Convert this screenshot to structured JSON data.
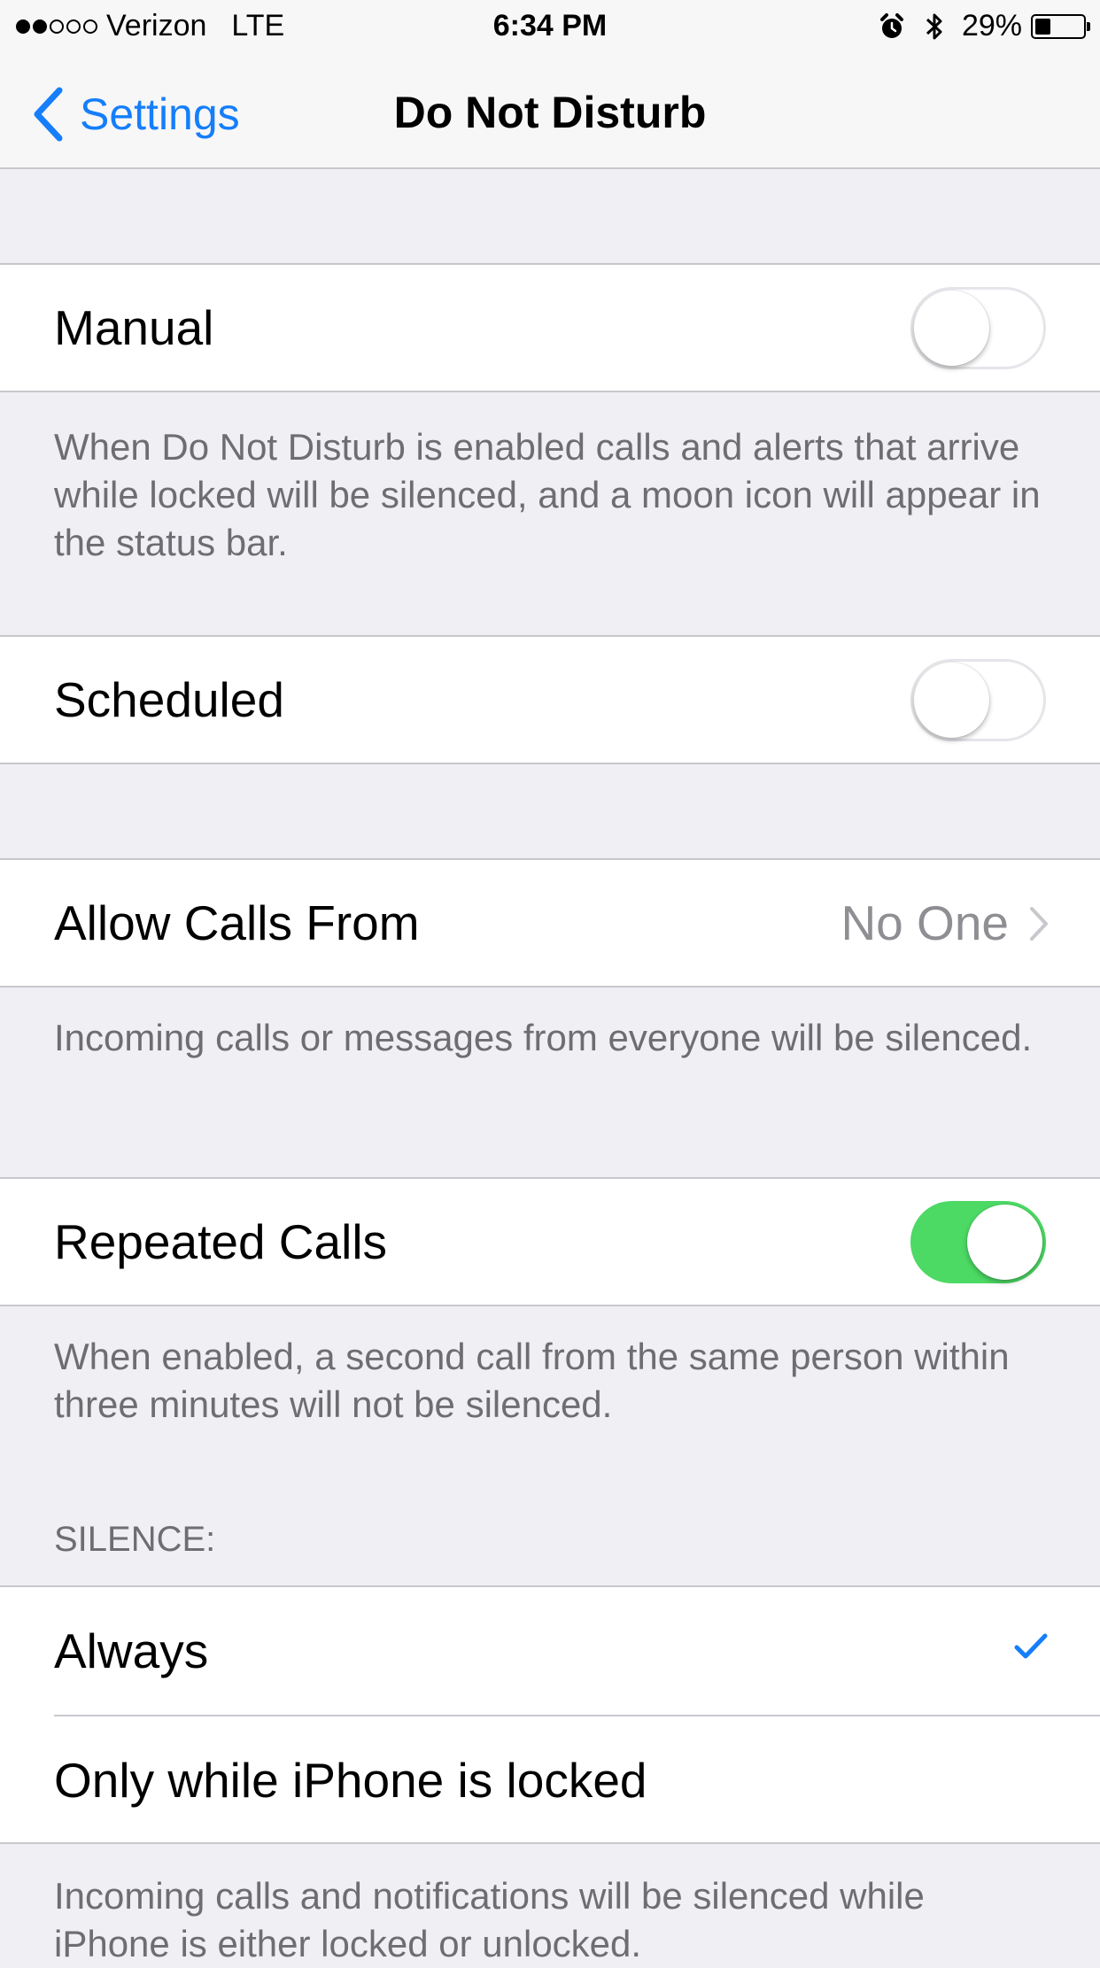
{
  "status_bar": {
    "signal_strength": "2 of 5",
    "carrier": "Verizon",
    "network": "LTE",
    "time": "6:34 PM",
    "battery": "29%",
    "icons": [
      "alarm-icon",
      "bluetooth-icon",
      "battery-icon"
    ]
  },
  "nav": {
    "back_label": "Settings",
    "title": "Do Not Disturb"
  },
  "manual": {
    "label": "Manual",
    "enabled": false,
    "footer": "When Do Not Disturb is enabled calls and alerts that arrive while locked will be silenced, and a moon icon will appear in the status bar."
  },
  "scheduled": {
    "label": "Scheduled",
    "enabled": false
  },
  "allow_calls": {
    "label": "Allow Calls From",
    "value": "No One",
    "footer": "Incoming calls or messages from everyone will be silenced."
  },
  "repeated_calls": {
    "label": "Repeated Calls",
    "enabled": true,
    "footer": "When enabled, a second call from the same person within three minutes will not be silenced."
  },
  "silence": {
    "header": "SILENCE:",
    "options": [
      {
        "label": "Always",
        "selected": true
      },
      {
        "label": "Only while iPhone is locked",
        "selected": false
      }
    ],
    "footer": "Incoming calls and notifications will be silenced while iPhone is either locked or unlocked."
  },
  "colors": {
    "accent": "#157efb",
    "toggle_on": "#4cd964",
    "background": "#efeff4"
  }
}
